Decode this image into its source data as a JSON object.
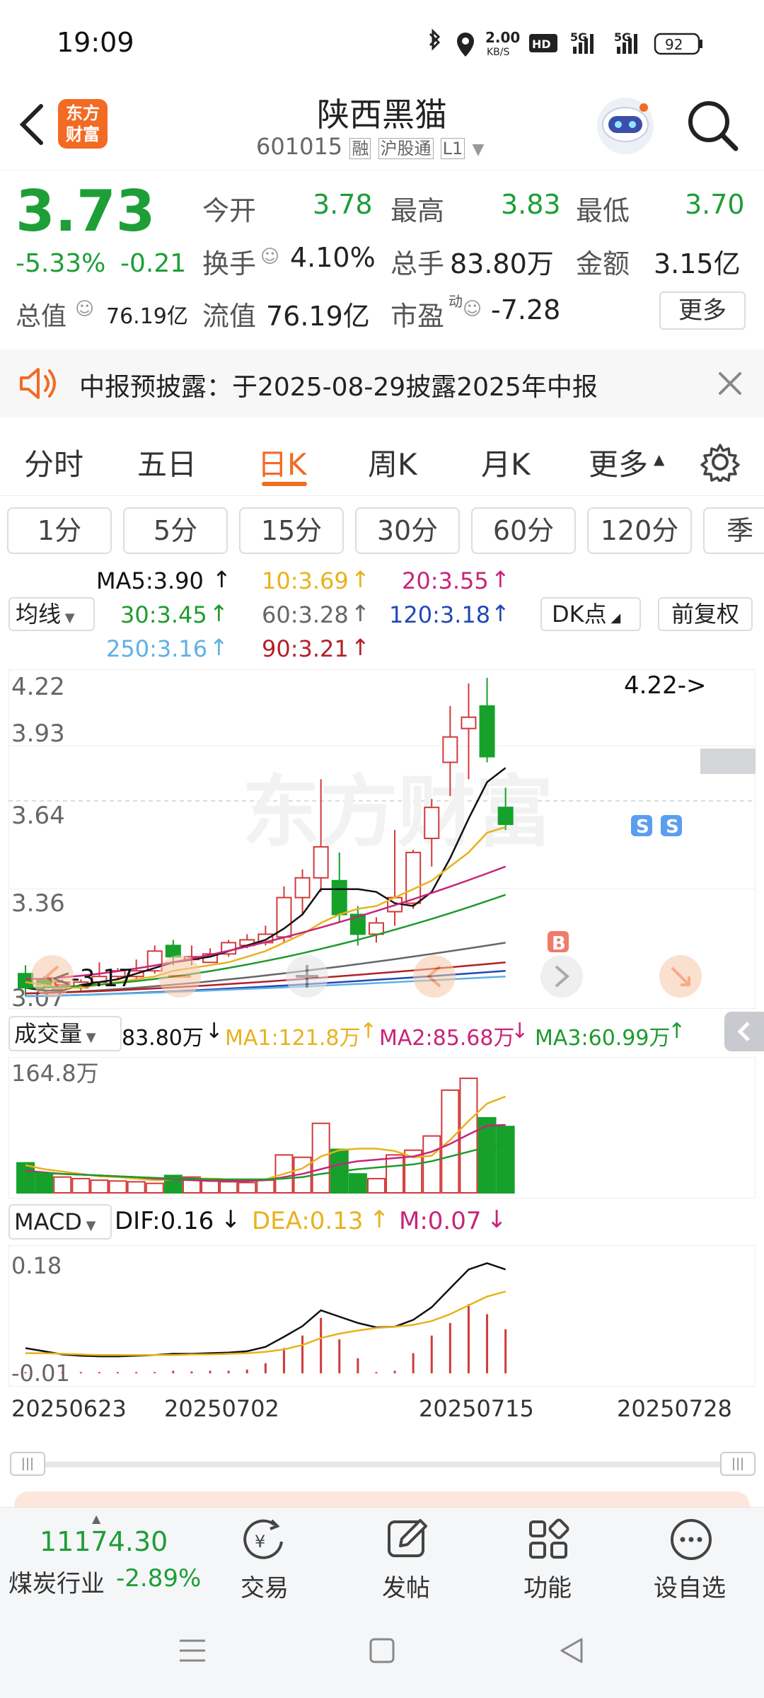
{
  "status": {
    "time": "19:09",
    "net_speed_top": "2.00",
    "net_speed_bottom": "KB/S",
    "hd": "HD",
    "sig1": "5G",
    "sig2": "5G",
    "battery": "92"
  },
  "header": {
    "title": "陕西黑猫",
    "code": "601015",
    "badges": [
      "融",
      "沪股通",
      "L1"
    ],
    "logo_line1": "东方",
    "logo_line2": "财富"
  },
  "quote": {
    "price": "3.73",
    "change_pct": "-5.33%",
    "change_amt": "-0.21",
    "open_label": "今开",
    "open": "3.78",
    "high_label": "最高",
    "high": "3.83",
    "low_label": "最低",
    "low": "3.70",
    "turnover_label": "换手",
    "turnover": "4.10%",
    "volume_label": "总手",
    "volume": "83.80万",
    "amount_label": "金额",
    "amount": "3.15亿",
    "mktcap_label": "总值",
    "mktcap": "76.19亿",
    "float_label": "流值",
    "float_cap": "76.19亿",
    "pe_label": "市盈",
    "pe_sup": "动",
    "pe": "-7.28",
    "more": "更多"
  },
  "notice": {
    "text": "中报预披露：于2025-08-29披露2025年中报"
  },
  "tabs": [
    "分时",
    "五日",
    "日K",
    "周K",
    "月K",
    "更多"
  ],
  "periods": [
    "1分",
    "5分",
    "15分",
    "30分",
    "60分",
    "120分",
    "季"
  ],
  "ma": {
    "selector": "均线",
    "ma5": "MA5:3.90",
    "ma10": "10:3.69",
    "ma20": "20:3.55",
    "ma30": "30:3.45",
    "ma60": "60:3.28",
    "ma120": "120:3.18",
    "ma250": "250:3.16",
    "ma90": "90:3.21",
    "dk": "DK点",
    "fq": "前复权"
  },
  "colors": {
    "ma5": "#111111",
    "ma10": "#e8b21c",
    "ma20": "#c8247a",
    "ma30": "#1f9a2e",
    "ma60": "#666666",
    "ma120": "#2348b5",
    "ma250": "#5fb0e6",
    "ma90": "#b32028",
    "up": "#d23a3a",
    "down": "#16a12b"
  },
  "kline_axis": {
    "y1": "4.22",
    "y2": "3.93",
    "y3": "3.64",
    "y4": "3.36",
    "y5": "3.07",
    "max_label": "4.22->",
    "min_label": "<-3.17",
    "buy": "B",
    "sell": "S"
  },
  "volume": {
    "selector": "成交量",
    "current": "83.80万",
    "ma1": "MA1:121.8万",
    "ma2": "MA2:85.68万",
    "ma3": "MA3:60.99万",
    "max": "164.8万"
  },
  "macd": {
    "selector": "MACD",
    "dif": "DIF:0.16",
    "dea": "DEA:0.13",
    "m": "M:0.07",
    "top": "0.18",
    "bottom": "-0.01"
  },
  "dates": [
    "20250623",
    "20250702",
    "20250715",
    "20250728"
  ],
  "chart_data": {
    "type": "candlestick",
    "candles": [
      {
        "o": 3.17,
        "c": 3.12,
        "h": 3.2,
        "l": 3.09
      },
      {
        "o": 3.15,
        "c": 3.13,
        "h": 3.16,
        "l": 3.11
      },
      {
        "o": 3.13,
        "c": 3.14,
        "h": 3.15,
        "l": 3.11
      },
      {
        "o": 3.12,
        "c": 3.14,
        "h": 3.15,
        "l": 3.11
      },
      {
        "o": 3.14,
        "c": 3.16,
        "h": 3.21,
        "l": 3.13
      },
      {
        "o": 3.16,
        "c": 3.18,
        "h": 3.19,
        "l": 3.15
      },
      {
        "o": 3.16,
        "c": 3.18,
        "h": 3.22,
        "l": 3.15
      },
      {
        "o": 3.18,
        "c": 3.25,
        "h": 3.27,
        "l": 3.17
      },
      {
        "o": 3.27,
        "c": 3.23,
        "h": 3.29,
        "l": 3.2
      },
      {
        "o": 3.22,
        "c": 3.23,
        "h": 3.27,
        "l": 3.2
      },
      {
        "o": 3.21,
        "c": 3.24,
        "h": 3.26,
        "l": 3.21
      },
      {
        "o": 3.24,
        "c": 3.28,
        "h": 3.29,
        "l": 3.23
      },
      {
        "o": 3.27,
        "c": 3.29,
        "h": 3.31,
        "l": 3.26
      },
      {
        "o": 3.28,
        "c": 3.31,
        "h": 3.34,
        "l": 3.27
      },
      {
        "o": 3.3,
        "c": 3.44,
        "h": 3.48,
        "l": 3.28
      },
      {
        "o": 3.44,
        "c": 3.51,
        "h": 3.54,
        "l": 3.38
      },
      {
        "o": 3.51,
        "c": 3.62,
        "h": 3.86,
        "l": 3.46
      },
      {
        "o": 3.5,
        "c": 3.38,
        "h": 3.6,
        "l": 3.35
      },
      {
        "o": 3.38,
        "c": 3.31,
        "h": 3.41,
        "l": 3.27
      },
      {
        "o": 3.31,
        "c": 3.35,
        "h": 3.37,
        "l": 3.28
      },
      {
        "o": 3.39,
        "c": 3.44,
        "h": 3.68,
        "l": 3.34
      },
      {
        "o": 3.42,
        "c": 3.6,
        "h": 3.61,
        "l": 3.4
      },
      {
        "o": 3.65,
        "c": 3.76,
        "h": 3.79,
        "l": 3.55
      },
      {
        "o": 3.92,
        "c": 4.01,
        "h": 4.12,
        "l": 3.8
      },
      {
        "o": 4.04,
        "c": 4.08,
        "h": 4.2,
        "l": 3.86
      },
      {
        "o": 4.12,
        "c": 3.94,
        "h": 4.22,
        "l": 3.92
      },
      {
        "o": 3.76,
        "c": 3.7,
        "h": 3.83,
        "l": 3.68
      }
    ],
    "ma5": [
      3.12,
      3.11,
      3.11,
      3.13,
      3.14,
      3.15,
      3.17,
      3.19,
      3.21,
      3.22,
      3.23,
      3.25,
      3.27,
      3.29,
      3.33,
      3.38,
      3.47,
      3.47,
      3.47,
      3.46,
      3.42,
      3.41,
      3.46,
      3.58,
      3.72,
      3.85,
      3.9
    ],
    "ma10": [
      3.14,
      3.13,
      3.12,
      3.12,
      3.13,
      3.14,
      3.15,
      3.16,
      3.18,
      3.19,
      3.2,
      3.21,
      3.23,
      3.25,
      3.28,
      3.31,
      3.35,
      3.38,
      3.4,
      3.41,
      3.44,
      3.47,
      3.5,
      3.55,
      3.6,
      3.67,
      3.69
    ],
    "volume": [
      38,
      24,
      20,
      18,
      16,
      15,
      14,
      12,
      22,
      20,
      18,
      14,
      13,
      16,
      48,
      45,
      88,
      55,
      24,
      18,
      48,
      54,
      72,
      130,
      145,
      95,
      84
    ],
    "vol_ma1": [
      35,
      30,
      27,
      24,
      21,
      20,
      18,
      16,
      17,
      18,
      18,
      17,
      17,
      17,
      24,
      31,
      46,
      54,
      56,
      56,
      53,
      45,
      47,
      67,
      91,
      113,
      122
    ],
    "vol_ma2": [
      28,
      26,
      24,
      23,
      22,
      21,
      20,
      18,
      17,
      16,
      15,
      15,
      15,
      16,
      20,
      24,
      30,
      36,
      40,
      42,
      44,
      46,
      52,
      62,
      74,
      85,
      86
    ],
    "vol_ma3": [
      26,
      25,
      24,
      23,
      22,
      21,
      20,
      19,
      18,
      18,
      17,
      17,
      17,
      17,
      18,
      20,
      24,
      27,
      30,
      32,
      34,
      36,
      40,
      46,
      52,
      58,
      61
    ],
    "dif": [
      0.04,
      0.035,
      0.03,
      0.028,
      0.027,
      0.027,
      0.028,
      0.029,
      0.031,
      0.031,
      0.032,
      0.033,
      0.035,
      0.042,
      0.058,
      0.075,
      0.1,
      0.09,
      0.08,
      0.073,
      0.074,
      0.085,
      0.105,
      0.135,
      0.165,
      0.175,
      0.165
    ],
    "dea": [
      0.032,
      0.032,
      0.031,
      0.03,
      0.029,
      0.029,
      0.029,
      0.029,
      0.029,
      0.03,
      0.03,
      0.031,
      0.032,
      0.034,
      0.038,
      0.045,
      0.056,
      0.063,
      0.068,
      0.072,
      0.074,
      0.077,
      0.083,
      0.094,
      0.108,
      0.122,
      0.13
    ],
    "macd_bar": [
      0.002,
      0.002,
      0.002,
      0.002,
      0.002,
      0.002,
      0.002,
      0.002,
      0.004,
      0.003,
      0.004,
      0.004,
      0.006,
      0.016,
      0.04,
      0.06,
      0.088,
      0.054,
      0.024,
      0.002,
      0.004,
      0.032,
      0.06,
      0.08,
      0.11,
      0.094,
      0.07
    ],
    "ylim": [
      3.07,
      4.22
    ]
  },
  "bottom": {
    "index_value": "11174.30",
    "industry": "煤炭行业",
    "industry_change": "-2.89%",
    "trade": "交易",
    "post": "发帖",
    "func": "功能",
    "watch": "设自选"
  }
}
